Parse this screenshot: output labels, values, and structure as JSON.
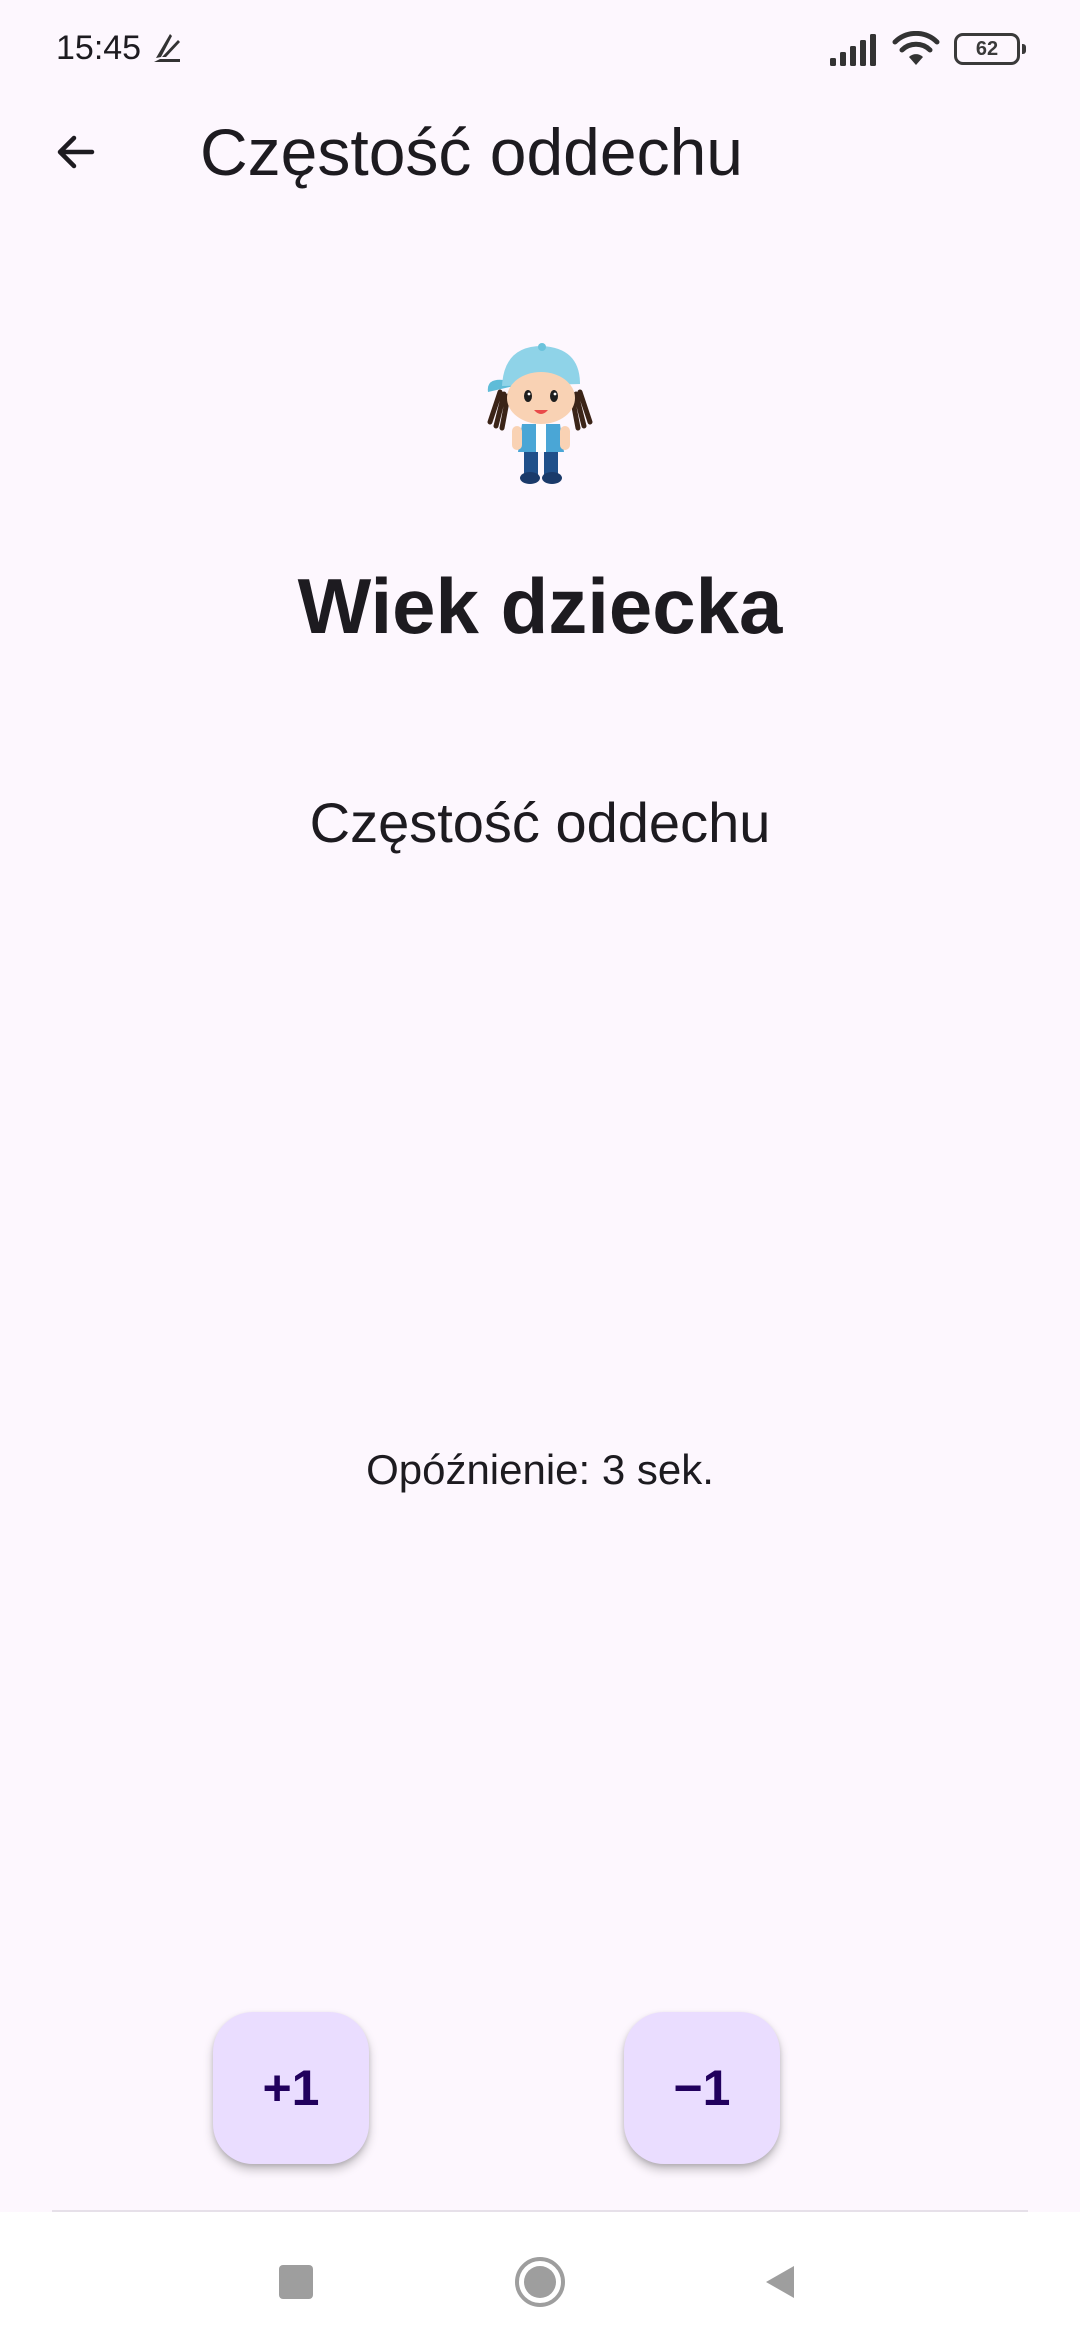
{
  "status_bar": {
    "time": "15:45",
    "battery": "62",
    "icons": [
      "app-notification-icon",
      "signal-icon",
      "wifi-icon",
      "battery-icon"
    ]
  },
  "app_bar": {
    "title": "Częstość oddechu",
    "back_icon": "arrow-back-icon"
  },
  "main": {
    "mascot_icon": "child-mascot",
    "heading": "Wiek dziecka",
    "subheading": "Częstość oddechu",
    "delay_text": "Opóźnienie: 3 sek."
  },
  "actions": {
    "plus_label": "+1",
    "minus_label": "−1"
  },
  "nav_bar": {
    "icons": [
      "recents-icon",
      "home-icon",
      "back-icon"
    ]
  },
  "colors": {
    "background": "#fdf7fe",
    "fab_background": "#eaddff",
    "fab_text": "#21005d",
    "text": "#1d1b20"
  }
}
